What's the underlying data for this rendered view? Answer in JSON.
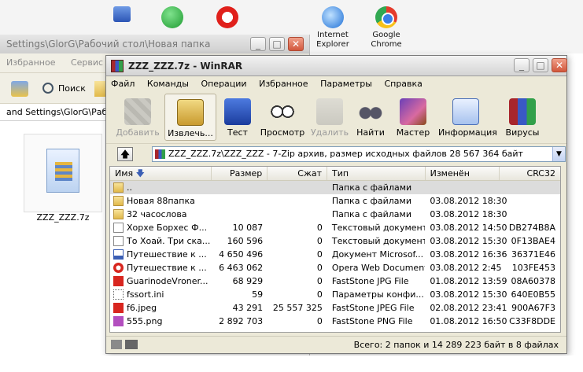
{
  "desktop": {
    "icons": [
      {
        "label": "",
        "icon": "monitor-icon"
      },
      {
        "label": "",
        "icon": "network-icon"
      },
      {
        "label": "",
        "icon": "opera-icon"
      },
      {
        "label": "Internet Explorer",
        "icon": "ie-icon"
      },
      {
        "label": "Google Chrome",
        "icon": "chrome-icon"
      }
    ]
  },
  "explorer": {
    "title": "Settings\\GlorG\\Рабочий стол\\Новая папка",
    "menu": [
      "Избранное",
      "Сервис"
    ],
    "search_label": "Поиск",
    "address": "and Settings\\GlorG\\Рабочий",
    "file_name": "ZZZ_ZZZ.7z"
  },
  "winrar": {
    "title": "ZZZ_ZZZ.7z - WinRAR",
    "menu": [
      "Файл",
      "Команды",
      "Операции",
      "Избранное",
      "Параметры",
      "Справка"
    ],
    "toolbar": [
      {
        "label": "Добавить",
        "icon": "add-icon",
        "disabled": true
      },
      {
        "label": "Извлечь...",
        "icon": "extract-icon",
        "disabled": false
      },
      {
        "label": "Тест",
        "icon": "test-icon",
        "disabled": false
      },
      {
        "label": "Просмотр",
        "icon": "view-icon",
        "disabled": false
      },
      {
        "label": "Удалить",
        "icon": "delete-icon",
        "disabled": true
      },
      {
        "label": "Найти",
        "icon": "find-icon",
        "disabled": false
      },
      {
        "label": "Мастер",
        "icon": "wizard-icon",
        "disabled": false
      },
      {
        "label": "Информация",
        "icon": "info-icon",
        "disabled": false
      },
      {
        "label": "Вирусы",
        "icon": "virus-scan-icon",
        "disabled": false
      }
    ],
    "path": "ZZZ_ZZZ.7z\\ZZZ_ZZZ - 7-Zip архив, размер исходных файлов 28 567 364 байт",
    "columns": [
      "Имя",
      "Размер",
      "Сжат",
      "Тип",
      "Изменён",
      "CRC32"
    ],
    "rows": [
      {
        "name": "..",
        "size": "",
        "packed": "",
        "type": "Папка с файлами",
        "modified": "",
        "crc": "",
        "icon": "folder"
      },
      {
        "name": "Новая 88папка",
        "size": "",
        "packed": "",
        "type": "Папка с файлами",
        "modified": "03.08.2012 18:30",
        "crc": "",
        "icon": "folder"
      },
      {
        "name": "32 часословa",
        "size": "",
        "packed": "",
        "type": "Папка с файлами",
        "modified": "03.08.2012 18:30",
        "crc": "",
        "icon": "folder"
      },
      {
        "name": "Хорхе Борхес Ф...",
        "size": "10 087",
        "packed": "0",
        "type": "Текстовый документ",
        "modified": "03.08.2012 14:50",
        "crc": "DB274B8A",
        "icon": "txt"
      },
      {
        "name": "То Хоай. Три ска...",
        "size": "160 596",
        "packed": "0",
        "type": "Текстовый документ",
        "modified": "03.08.2012 15:30",
        "crc": "0F13BAE4",
        "icon": "txt"
      },
      {
        "name": "Путешествие к ...",
        "size": "4 650 496",
        "packed": "0",
        "type": "Документ Microsof...",
        "modified": "03.08.2012 16:36",
        "crc": "36371E46",
        "icon": "doc"
      },
      {
        "name": "Путешествие к ...",
        "size": "6 463 062",
        "packed": "0",
        "type": "Opera Web Document",
        "modified": "03.08.2012 2:45",
        "crc": "103FE453",
        "icon": "opera"
      },
      {
        "name": "GuarinodeVroner...",
        "size": "68 929",
        "packed": "0",
        "type": "FastStone JPG File",
        "modified": "01.08.2012 13:59",
        "crc": "08A60378",
        "icon": "jpg"
      },
      {
        "name": "fssort.ini",
        "size": "59",
        "packed": "0",
        "type": "Параметры конфи...",
        "modified": "03.08.2012 15:30",
        "crc": "640E0B55",
        "icon": "ini"
      },
      {
        "name": "f6.jpeg",
        "size": "43 291",
        "packed": "25 557 325",
        "type": "FastStone JPEG File",
        "modified": "02.08.2012 23:41",
        "crc": "900A67F3",
        "icon": "jpg"
      },
      {
        "name": "555.png",
        "size": "2 892 703",
        "packed": "0",
        "type": "FastStone PNG File",
        "modified": "01.08.2012 16:50",
        "crc": "C33F8DDE",
        "icon": "png"
      }
    ],
    "status": "Всего: 2 папок и 14 289 223 байт в 8 файлах"
  }
}
